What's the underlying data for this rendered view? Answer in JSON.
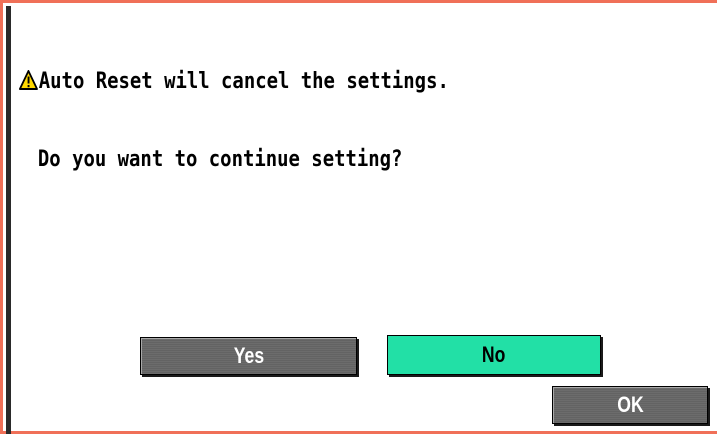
{
  "dialog": {
    "icon": "warning-triangle-icon",
    "message_line1": "Auto Reset will cancel the settings.",
    "message_line2": "Do you want to continue setting?"
  },
  "buttons": {
    "yes_label": "Yes",
    "no_label": "No",
    "ok_label": "OK"
  },
  "colors": {
    "frame_border": "#f07058",
    "selected_button": "#22e0a6",
    "unselected_button": "#666666",
    "warning_icon_fill": "#ffd800"
  }
}
